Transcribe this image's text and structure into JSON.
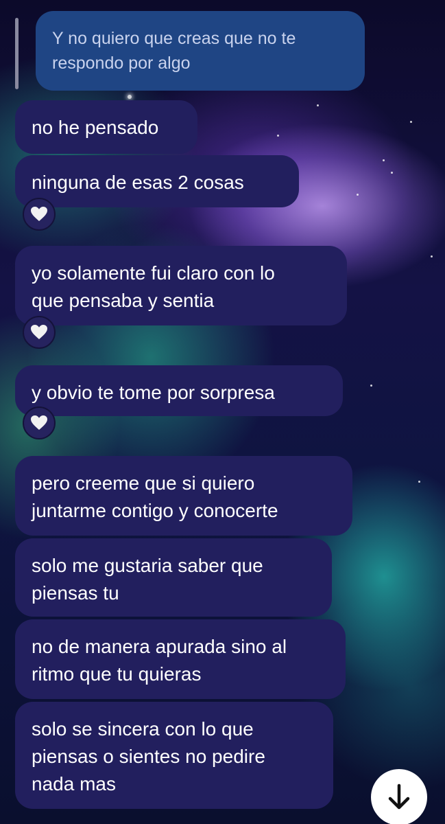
{
  "chat": {
    "quoted_reply": {
      "text": "Y no quiero que creas que no te\nrespondo por algo"
    },
    "messages": [
      {
        "text": "no he pensado",
        "reaction": null
      },
      {
        "text": "ninguna de esas 2 cosas",
        "reaction": "heart-icon"
      },
      {
        "text": "yo solamente fui claro con lo\nque pensaba y sentia",
        "reaction": "heart-icon"
      },
      {
        "text": "y obvio te tome por sorpresa",
        "reaction": "heart-icon"
      },
      {
        "text": "pero creeme que si quiero\njuntarme contigo y conocerte",
        "reaction": null
      },
      {
        "text": "solo me gustaria saber que\npiensas tu",
        "reaction": null
      },
      {
        "text": "no de manera apurada sino al\nritmo que tu quieras",
        "reaction": null
      },
      {
        "text": "solo se sincera con lo que\npiensas o sientes no pedire\nnada mas",
        "reaction": null
      }
    ]
  },
  "colors": {
    "incoming_bubble": "#221f5e",
    "quoted_bubble": "#1f4584",
    "reaction_heart": "#f2f2f2"
  },
  "icons": {
    "scroll_down": "arrow-down-icon",
    "reaction": "heart-icon"
  }
}
